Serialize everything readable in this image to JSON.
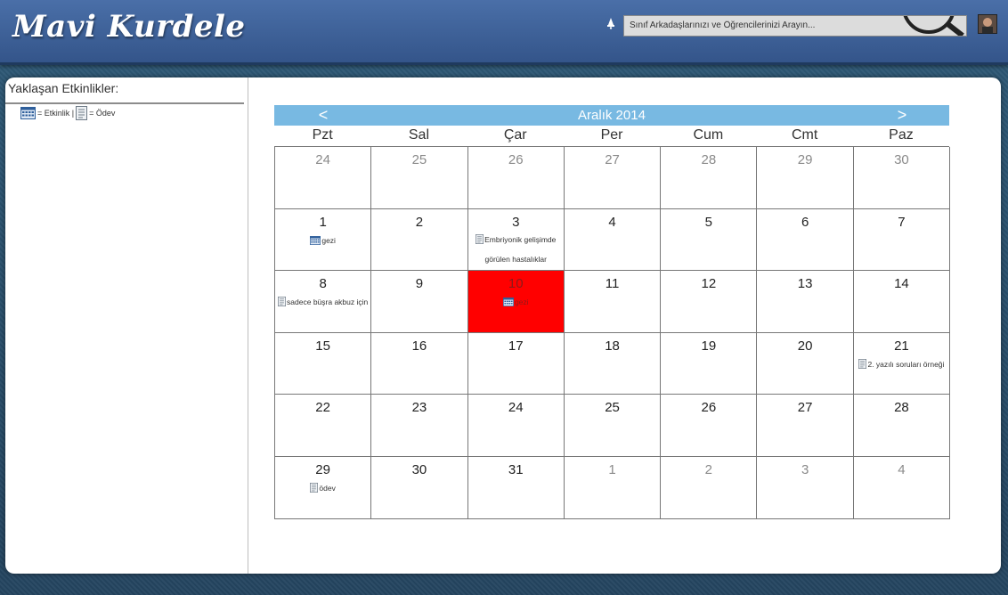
{
  "header": {
    "logo": "Mavi Kurdele",
    "search_placeholder": "Sınıf Arkadaşlarınızı ve Öğrencilerinizi Arayın..."
  },
  "sidebar": {
    "title": "Yaklaşan Etkinlikler:",
    "legend_event": "= Etkinlik |",
    "legend_homework": "= Ödev"
  },
  "calendar": {
    "prev_label": "<",
    "next_label": ">",
    "month": "Aralık 2014",
    "weekdays": [
      "Pzt",
      "Sal",
      "Çar",
      "Per",
      "Cum",
      "Cmt",
      "Paz"
    ],
    "days": [
      {
        "n": "24",
        "other": true
      },
      {
        "n": "25",
        "other": true
      },
      {
        "n": "26",
        "other": true
      },
      {
        "n": "27",
        "other": true
      },
      {
        "n": "28",
        "other": true
      },
      {
        "n": "29",
        "other": true
      },
      {
        "n": "30",
        "other": true
      },
      {
        "n": "1",
        "event": {
          "type": "etkinlik",
          "text": "gezi"
        }
      },
      {
        "n": "2"
      },
      {
        "n": "3",
        "event": {
          "type": "odev",
          "text": "Embriyonik gelişimde görülen hastalıklar"
        }
      },
      {
        "n": "4"
      },
      {
        "n": "5"
      },
      {
        "n": "6"
      },
      {
        "n": "7"
      },
      {
        "n": "8",
        "event": {
          "type": "odev",
          "text": "sadece büşra akbuz için"
        }
      },
      {
        "n": "9"
      },
      {
        "n": "10",
        "today": true,
        "event": {
          "type": "etkinlik",
          "text": "gezi"
        }
      },
      {
        "n": "11"
      },
      {
        "n": "12"
      },
      {
        "n": "13"
      },
      {
        "n": "14"
      },
      {
        "n": "15"
      },
      {
        "n": "16"
      },
      {
        "n": "17"
      },
      {
        "n": "18"
      },
      {
        "n": "19"
      },
      {
        "n": "20"
      },
      {
        "n": "21",
        "event": {
          "type": "odev",
          "text": "2. yazılı soruları örneği"
        }
      },
      {
        "n": "22"
      },
      {
        "n": "23"
      },
      {
        "n": "24"
      },
      {
        "n": "25"
      },
      {
        "n": "26"
      },
      {
        "n": "27"
      },
      {
        "n": "28"
      },
      {
        "n": "29",
        "event": {
          "type": "odev",
          "text": "ödev"
        }
      },
      {
        "n": "30"
      },
      {
        "n": "31"
      },
      {
        "n": "1",
        "other": true
      },
      {
        "n": "2",
        "other": true
      },
      {
        "n": "3",
        "other": true
      },
      {
        "n": "4",
        "other": true
      }
    ]
  },
  "colors": {
    "header": "#3b5d94",
    "calendar_header": "#78b9e2",
    "today": "#ff0000"
  }
}
